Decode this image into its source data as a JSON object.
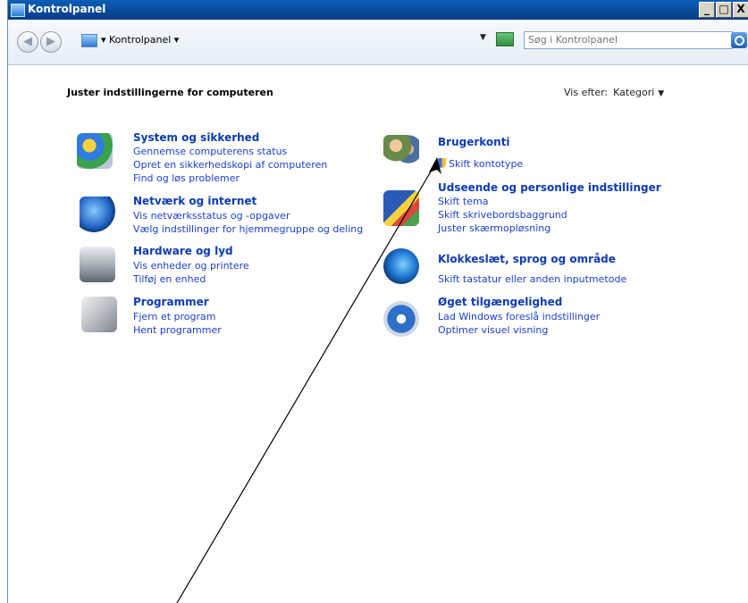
{
  "window": {
    "title": "Kontrolpanel",
    "controls": [
      "_",
      "□",
      "X"
    ]
  },
  "navbar": {
    "breadcrumb": "▾ Kontrolpanel ▾",
    "search_placeholder": "Søg i Kontrolpanel"
  },
  "main": {
    "heading": "Juster indstillingerne for computeren",
    "view_by_label": "Vis efter:",
    "view_by_value": "Kategori"
  },
  "left_categories": [
    {
      "title": "System og sikkerhed",
      "links": [
        "Gennemse computerens status",
        "Opret en sikkerhedskopi af computeren",
        "Find og løs problemer"
      ]
    },
    {
      "title": "Netværk og internet",
      "links": [
        "Vis netværksstatus og -opgaver",
        "Vælg indstillinger for hjemmegruppe og deling"
      ]
    },
    {
      "title": "Hardware og lyd",
      "links": [
        "Vis enheder og printere",
        "Tilføj en enhed"
      ]
    },
    {
      "title": "Programmer",
      "links": [
        "Fjern et program",
        "Hent programmer"
      ]
    }
  ],
  "right_categories": [
    {
      "title": "Brugerkonti",
      "links": [
        "Skift kontotype"
      ]
    },
    {
      "title": "Udseende og personlige indstillinger",
      "links": [
        "Skift tema",
        "Skift skrivebordsbaggrund",
        "Juster skærmopløsning"
      ]
    },
    {
      "title": "Klokkeslæt, sprog og område",
      "links": [
        "Skift tastatur eller anden inputmetode"
      ]
    },
    {
      "title": "Øget tilgængelighed",
      "links": [
        "Lad Windows foreslå indstillinger",
        "Optimer visuel visning"
      ]
    }
  ],
  "colors": {
    "link": "#1d3fd1",
    "category_title": "#0c3bb3",
    "titlebar": "#0a4a9c"
  }
}
